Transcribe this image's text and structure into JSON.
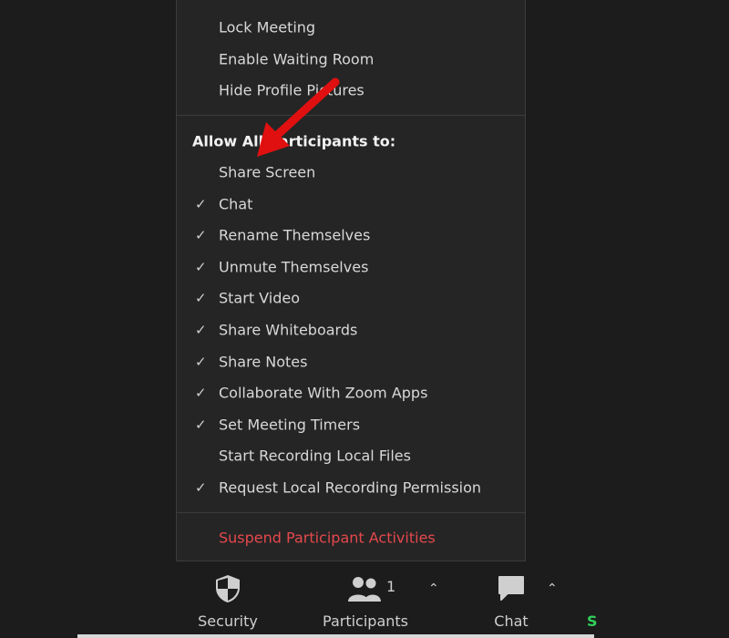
{
  "menu": {
    "top_items": [
      "Lock Meeting",
      "Enable Waiting Room",
      "Hide Profile Pictures"
    ],
    "section_header": "Allow All Participants to:",
    "permissions": [
      {
        "label": "Share Screen",
        "checked": false
      },
      {
        "label": "Chat",
        "checked": true
      },
      {
        "label": "Rename Themselves",
        "checked": true
      },
      {
        "label": "Unmute Themselves",
        "checked": true
      },
      {
        "label": "Start Video",
        "checked": true
      },
      {
        "label": "Share Whiteboards",
        "checked": true
      },
      {
        "label": "Share Notes",
        "checked": true
      },
      {
        "label": "Collaborate With Zoom Apps",
        "checked": true
      },
      {
        "label": "Set Meeting Timers",
        "checked": true
      },
      {
        "label": "Start Recording Local Files",
        "checked": false
      },
      {
        "label": "Request Local Recording Permission",
        "checked": true
      }
    ],
    "suspend_label": "Suspend Participant Activities",
    "check_glyph": "✓"
  },
  "toolbar": {
    "security_label": "Security",
    "participants_label": "Participants",
    "participants_count": "1",
    "chat_label": "Chat",
    "share_partial": "S"
  },
  "colors": {
    "danger": "#e5484d",
    "annotation_arrow": "#e01010",
    "share_green": "#2fd15a"
  }
}
